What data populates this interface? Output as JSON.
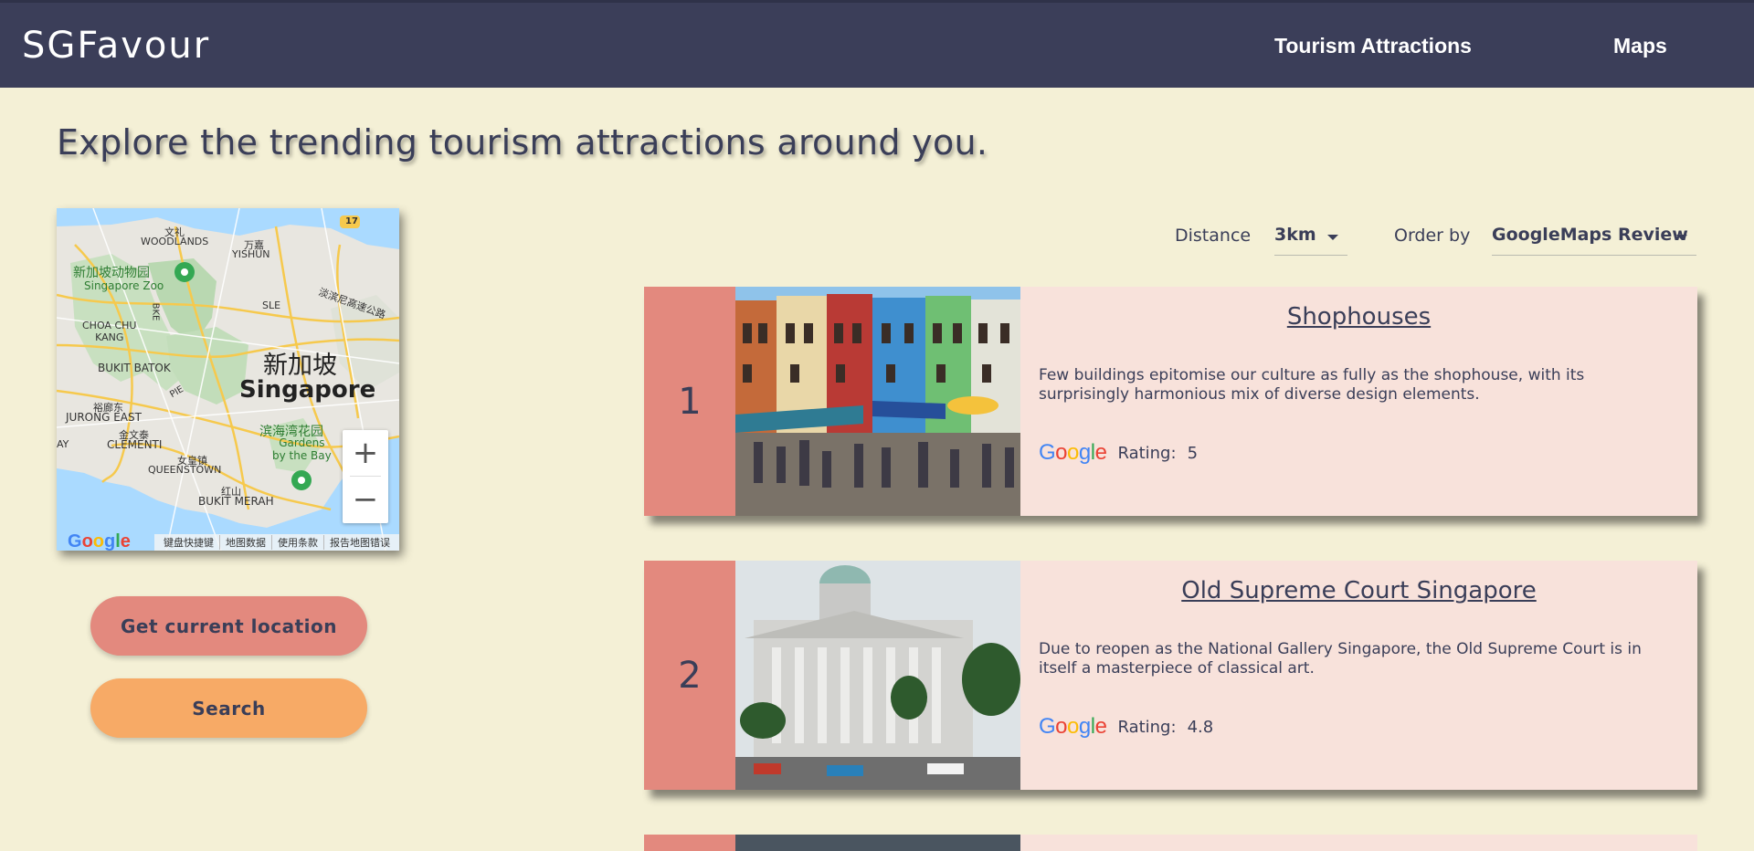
{
  "nav": {
    "brand": "SGFavour",
    "links": [
      "Tourism Attractions",
      "Maps"
    ]
  },
  "page": {
    "title": "Explore the trending tourism attractions around you."
  },
  "map": {
    "labels": {
      "woodlands": "WOODLANDS",
      "yishun": "YISHUN",
      "zoo_cn": "新加坡动物园",
      "zoo_en": "Singapore Zoo",
      "choa_chu_kang": "CHOA CHU\nKANG",
      "bukit_batok": "BUKIT BATOK",
      "sg_cn": "新加坡",
      "sg_en": "Singapore",
      "jurong_east": "JURONG EAST",
      "clementi": "CLEMENTI",
      "queenstown": "QUEENSTOWN",
      "gardens_cn": "滨海湾花园",
      "gardens_en": "Gardens\nby the Bay",
      "bukit_merah": "BUKIT MERAH",
      "sle": "SLE",
      "bke": "BKE",
      "pie": "PIE",
      "road_17": "17",
      "tpe_cn": "淡滨尼高速公路",
      "wenli": "文礼",
      "wanhao": "万嘉",
      "jurong_cn": "裕廊东",
      "jinwen": "金文泰",
      "nv": "女皇镇",
      "hongshan": "红山",
      "ay": "AY"
    },
    "zoom_in": "+",
    "zoom_out": "−",
    "google": "Google",
    "attribution": [
      "键盘快捷键",
      "地图数据",
      "使用条款",
      "报告地图错误"
    ]
  },
  "buttons": {
    "location": "Get current location",
    "search": "Search"
  },
  "filters": {
    "distance_label": "Distance",
    "distance_value": "3km",
    "order_label": "Order by",
    "order_value": "GoogleMaps Review"
  },
  "attractions": [
    {
      "rank": "1",
      "name": "Shophouses",
      "description": "Few buildings epitomise our culture as fully as the shophouse, with its surprisingly harmonious mix of diverse design elements.",
      "rating_label": "Rating:",
      "rating": "5"
    },
    {
      "rank": "2",
      "name": "Old Supreme Court Singapore",
      "description": "Due to reopen as the National Gallery Singapore, the Old Supreme Court is in itself a masterpiece of classical art.",
      "rating_label": "Rating:",
      "rating": "4.8"
    }
  ],
  "colors": {
    "background": "#f4f0d6",
    "navbar": "#3b3e59",
    "text": "#3a3e58",
    "rank": "#e3897e",
    "card": "#f8e2db",
    "search_button": "#f7aa66"
  }
}
